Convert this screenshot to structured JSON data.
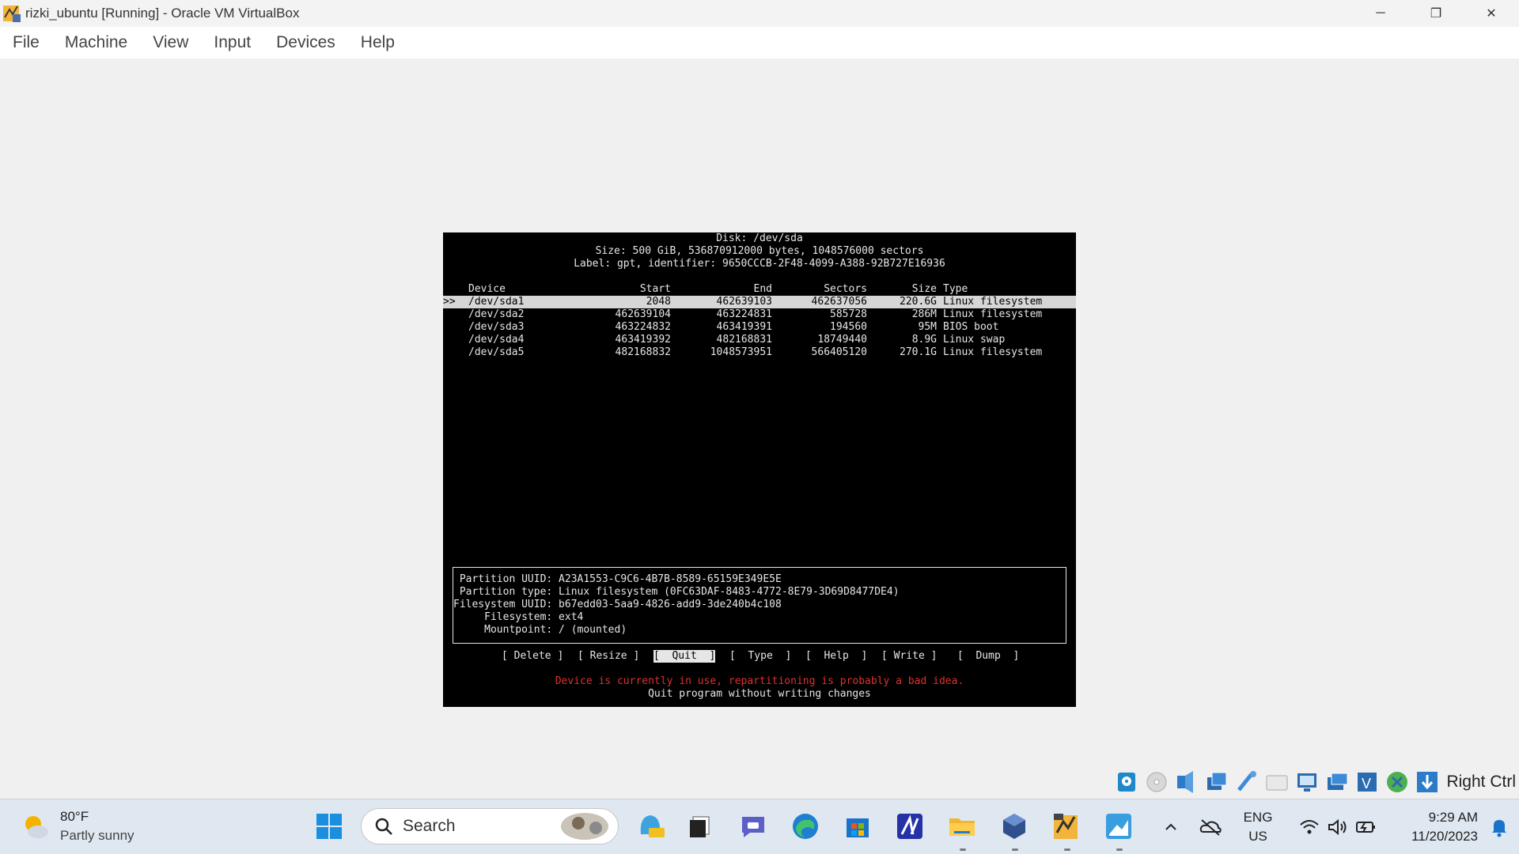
{
  "window": {
    "title": "rizki_ubuntu [Running] - Oracle VM VirtualBox",
    "controls": {
      "minimize": "─",
      "restore": "❐",
      "close": "✕"
    }
  },
  "menubar": {
    "items": [
      "File",
      "Machine",
      "View",
      "Input",
      "Devices",
      "Help"
    ]
  },
  "terminal": {
    "disk_line": "Disk: /dev/sda",
    "size_line": "Size: 500 GiB, 536870912000 bytes, 1048576000 sectors",
    "label_line": "Label: gpt, identifier: 9650CCCB-2F48-4099-A388-92B727E16936",
    "headers": {
      "device": "Device",
      "start": "Start",
      "end": "End",
      "sectors": "Sectors",
      "size": "Size",
      "type": "Type"
    },
    "selected_marker": ">>",
    "partitions": [
      {
        "device": "/dev/sda1",
        "start": "2048",
        "end": "462639103",
        "sectors": "462637056",
        "size": "220.6G",
        "type": "Linux filesystem"
      },
      {
        "device": "/dev/sda2",
        "start": "462639104",
        "end": "463224831",
        "sectors": "585728",
        "size": "286M",
        "type": "Linux filesystem"
      },
      {
        "device": "/dev/sda3",
        "start": "463224832",
        "end": "463419391",
        "sectors": "194560",
        "size": "95M",
        "type": "BIOS boot"
      },
      {
        "device": "/dev/sda4",
        "start": "463419392",
        "end": "482168831",
        "sectors": "18749440",
        "size": "8.9G",
        "type": "Linux swap"
      },
      {
        "device": "/dev/sda5",
        "start": "482168832",
        "end": "1048573951",
        "sectors": "566405120",
        "size": "270.1G",
        "type": "Linux filesystem"
      }
    ],
    "info": {
      "partition_uuid": " Partition UUID: A23A1553-C9C6-4B7B-8589-65159E349E5E",
      "partition_type": " Partition type: Linux filesystem (0FC63DAF-8483-4772-8E79-3D69D8477DE4)",
      "filesystem_uuid": "Filesystem UUID: b67edd03-5aa9-4826-add9-3de240b4c108",
      "filesystem": "     Filesystem: ext4",
      "mountpoint": "     Mountpoint: / (mounted)"
    },
    "buttons": {
      "delete": "[ Delete ]",
      "resize": "[ Resize ]",
      "quit": "[  Quit  ]",
      "type": "[  Type  ]",
      "help": "[  Help  ]",
      "write": "[ Write ]",
      "dump": "[  Dump  ]"
    },
    "warning": "Device is currently in use, repartitioning is probably a bad idea.",
    "hint": "Quit program without writing changes"
  },
  "statusbar": {
    "host_key": "Right Ctrl",
    "icons": [
      "hard-disk-icon",
      "optical-drive-icon",
      "audio-icon",
      "network-icon",
      "usb-icon",
      "shared-folders-icon",
      "display-icon",
      "recording-icon",
      "virtualization-icon",
      "mouse-integration-icon",
      "keyboard-capture-icon"
    ]
  },
  "taskbar": {
    "weather_temp": "80°F",
    "weather_desc": "Partly sunny",
    "search_placeholder": "Search",
    "lang_line1": "ENG",
    "lang_line2": "US",
    "time": "9:29 AM",
    "date": "11/20/2023"
  },
  "colors": {
    "terminal_bg": "#000000",
    "terminal_fg": "#e6e6e6",
    "selected_row_bg": "#d6d6d6",
    "warning": "#e03030",
    "taskbar_bg": "#dfe7f1"
  }
}
